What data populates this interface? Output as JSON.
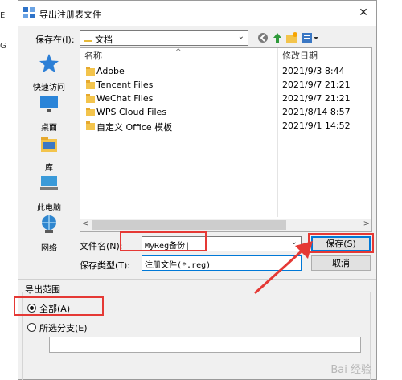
{
  "background": {
    "chars": [
      "E",
      "G"
    ]
  },
  "dialog": {
    "title": "导出注册表文件",
    "close_glyph": "✕"
  },
  "save_in": {
    "label": "保存在(I):",
    "value": "文档",
    "arrow": "⌄"
  },
  "places": [
    {
      "label": "快速访问",
      "icon": "star-icon"
    },
    {
      "label": "桌面",
      "icon": "desktop-icon"
    },
    {
      "label": "库",
      "icon": "library-icon"
    },
    {
      "label": "此电脑",
      "icon": "computer-icon"
    },
    {
      "label": "网络",
      "icon": "network-icon"
    }
  ],
  "list": {
    "columns": {
      "name": "名称",
      "date": "修改日期"
    },
    "sort_caret": "^",
    "rows": [
      {
        "name": "Adobe",
        "date": "2021/9/3 8:44"
      },
      {
        "name": "Tencent Files",
        "date": "2021/9/7 21:21"
      },
      {
        "name": "WeChat Files",
        "date": "2021/9/7 21:21"
      },
      {
        "name": "WPS Cloud Files",
        "date": "2021/8/14 8:57"
      },
      {
        "name": "自定义 Office 模板",
        "date": "2021/9/1 14:52"
      }
    ],
    "scroll_left": "<",
    "scroll_right": ">"
  },
  "filename": {
    "label": "文件名(N):",
    "value": "MyReg备份|",
    "arrow": "⌄"
  },
  "filetype": {
    "label": "保存类型(T):",
    "value": "注册文件(*.reg)"
  },
  "buttons": {
    "save": "保存(S)",
    "cancel": "取消"
  },
  "export_range": {
    "label": "导出范围",
    "all": "全部(A)",
    "branch": "所选分支(E)",
    "selected": "all"
  },
  "watermark": "Bai 经验",
  "colors": {
    "highlight": "#e53935",
    "accent": "#0078d7",
    "folder": "#f3c44c"
  }
}
